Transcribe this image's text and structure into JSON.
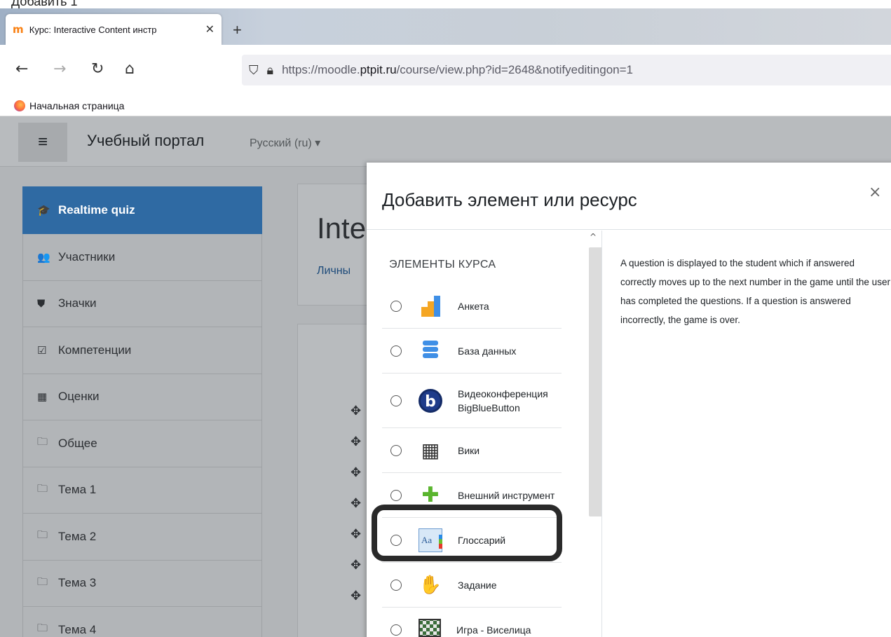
{
  "caption": "Добавить 1",
  "browser": {
    "tab_title": "Курс: Interactive Content инстр",
    "tab_close": "✕",
    "new_tab": "+",
    "url_host_prefix": "https://moodle.",
    "url_host_main": "ptpit.ru",
    "url_path": "/course/view.php?id=2648&notifyeditingon=1",
    "bookmark": "Начальная страница"
  },
  "moodle": {
    "site_name": "Учебный портал",
    "language": "Русский (ru) ▾",
    "course_title": "Inte",
    "breadcrumb": "Личны",
    "sidebar": [
      {
        "icon": "🎓",
        "label": "Realtime quiz",
        "active": true
      },
      {
        "icon": "👥",
        "label": "Участники"
      },
      {
        "icon": "⛊",
        "label": "Значки"
      },
      {
        "icon": "☑",
        "label": "Компетенции"
      },
      {
        "icon": "▦",
        "label": "Оценки"
      },
      {
        "icon": "🗀",
        "label": "Общее"
      },
      {
        "icon": "🗀",
        "label": "Тема 1"
      },
      {
        "icon": "🗀",
        "label": "Тема 2"
      },
      {
        "icon": "🗀",
        "label": "Тема 3"
      },
      {
        "icon": "🗀",
        "label": "Тема 4"
      }
    ]
  },
  "modal": {
    "title": "Добавить элемент или ресурс",
    "close": "×",
    "section_label": "ЭЛЕМЕНТЫ КУРСА",
    "options": [
      {
        "label": "Анкета",
        "icon": "chart-bars-icon"
      },
      {
        "label": "База данных",
        "icon": "database-icon"
      },
      {
        "label": "Видеоконференция BigBlueButton",
        "icon": "bigbluebutton-icon"
      },
      {
        "label": "Вики",
        "icon": "wiki-icon"
      },
      {
        "label": "Внешний инструмент",
        "icon": "puzzle-icon"
      },
      {
        "label": "Глоссарий",
        "icon": "glossary-icon"
      },
      {
        "label": "Задание",
        "icon": "assignment-icon"
      },
      {
        "label": "Игра - Виселица",
        "icon": "hangman-icon"
      }
    ],
    "description": "A question is displayed to the student which if answered correctly moves up to the next number in the game until the user has completed the questions. If a question is answered incorrectly, the game is over."
  }
}
